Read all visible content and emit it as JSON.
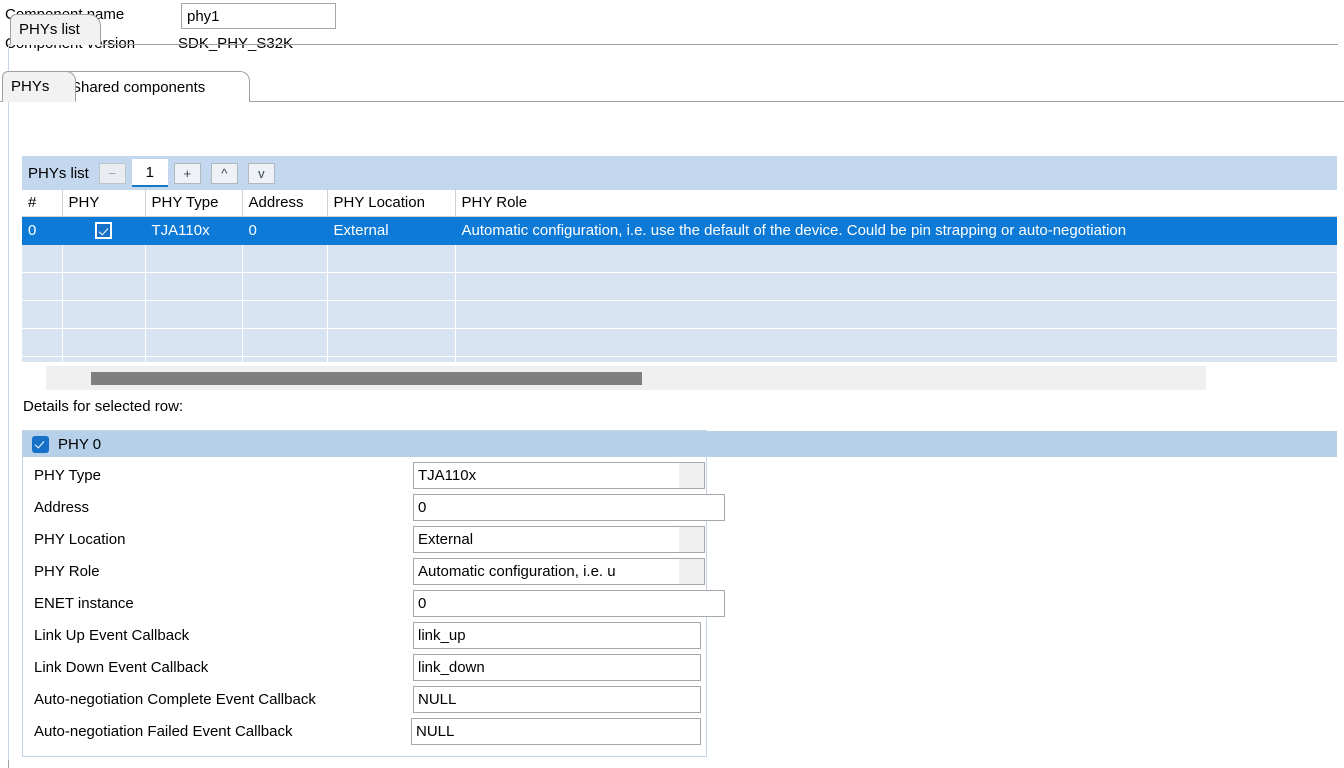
{
  "header": {
    "component_name_label": "Component name",
    "component_name_value": "phy1",
    "component_version_label": "Component version",
    "component_version_value": "SDK_PHY_S32K"
  },
  "tabs": {
    "outer": [
      {
        "label": "PHYs",
        "active": true
      },
      {
        "label": "Shared components",
        "active": false
      }
    ],
    "inner": [
      {
        "label": "PHYs list",
        "active": true
      }
    ]
  },
  "list_toolbar": {
    "title": "PHYs list",
    "remove_label": "−",
    "count_value": "1",
    "add_label": "+",
    "move_up_label": "^",
    "move_down_label": "v"
  },
  "table": {
    "columns": [
      "#",
      "PHY",
      "PHY Type",
      "Address",
      "PHY Location",
      "PHY Role"
    ],
    "rows": [
      {
        "index": "0",
        "phy_checked": true,
        "phy_type": "TJA110x",
        "address": "0",
        "phy_location": "External",
        "phy_role": "Automatic configuration, i.e. use the default of the device. Could be pin strapping or auto-negotiation",
        "selected": true
      }
    ],
    "empty_row_count": 4
  },
  "details": {
    "caption": "Details for selected row:",
    "group_title": "PHY 0",
    "group_checked": true,
    "fields": [
      {
        "label": "PHY Type",
        "value": "TJA110x",
        "kind": "combo"
      },
      {
        "label": "Address",
        "value": "0",
        "kind": "text-wide"
      },
      {
        "label": "PHY Location",
        "value": "External",
        "kind": "combo"
      },
      {
        "label": "PHY Role",
        "value": "Automatic configuration, i.e. u",
        "kind": "combo"
      },
      {
        "label": "ENET instance",
        "value": "0",
        "kind": "text-wide"
      },
      {
        "label": "Link Up Event Callback",
        "value": "link_up",
        "kind": "text-mid"
      },
      {
        "label": "Link Down Event Callback",
        "value": "link_down",
        "kind": "text-mid"
      },
      {
        "label": "Auto-negotiation Complete Event Callback",
        "value": "NULL",
        "kind": "text-cb"
      },
      {
        "label": "Auto-negotiation Failed Event Callback",
        "value": "NULL",
        "kind": "text-cb2"
      }
    ]
  },
  "colors": {
    "selection_blue": "#0d7ad8",
    "header_band_blue": "#b7d0ea",
    "toolbar_blue": "#c3d7ee",
    "empty_row_blue": "#d8e4f1",
    "scroll_thumb": "#7f7f7f",
    "focus_underline": "#1878c8"
  }
}
